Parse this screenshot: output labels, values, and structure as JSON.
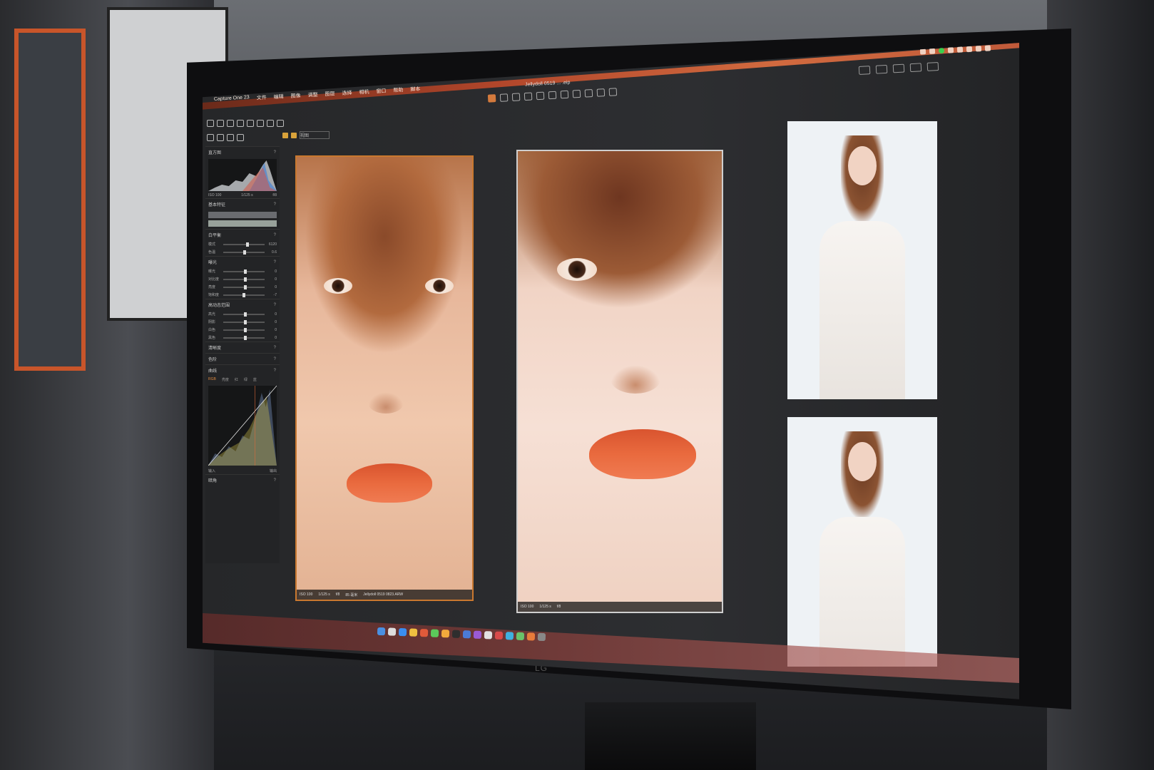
{
  "app": {
    "name": "Capture One 23",
    "document_title": "Jellydoll 0519 ... .eip"
  },
  "menu": {
    "items": [
      "Capture One 23",
      "文件",
      "编辑",
      "图像",
      "调整",
      "图层",
      "选择",
      "相机",
      "窗口",
      "帮助",
      "脚本"
    ]
  },
  "viewer": {
    "mode_label": "视图"
  },
  "left_panel": {
    "histogram_title": "直方图",
    "histogram_meta": [
      "ISO 100",
      "1/125 s",
      "f/8"
    ],
    "sections": {
      "basic": "基本特征",
      "white_balance": "白平衡",
      "exposure": "曝光",
      "hdr": "高动态范围",
      "clarity": "清晰度",
      "levels": "色阶",
      "curve": "曲线",
      "vignette": "暗角"
    },
    "wb_rows": [
      {
        "label": "模式",
        "value": "6120"
      },
      {
        "label": "色温",
        "value": "0.6"
      }
    ],
    "exposure_rows": [
      {
        "label": "曝光",
        "value": "0"
      },
      {
        "label": "对比度",
        "value": "0"
      },
      {
        "label": "亮度",
        "value": "0"
      },
      {
        "label": "饱和度",
        "value": "-7"
      }
    ],
    "hdr_rows": [
      {
        "label": "高光",
        "value": "0"
      },
      {
        "label": "阴影",
        "value": "0"
      },
      {
        "label": "白色",
        "value": "0"
      },
      {
        "label": "黑色",
        "value": "0"
      }
    ],
    "curve_tabs": [
      "RGB",
      "亮度",
      "红",
      "绿",
      "蓝"
    ],
    "curve_io": [
      "输入",
      "输出"
    ],
    "tool_label": "工具"
  },
  "photos": {
    "primary": {
      "caption": [
        "ISO 100",
        "1/125 s",
        "f/8",
        "85 毫米",
        "Jellydoll 0519 0823.ARW"
      ]
    },
    "secondary": {
      "caption": [
        "ISO 100",
        "1/125 s",
        "f/8"
      ]
    }
  },
  "colors": {
    "accent": "#d47a3d",
    "selection_frame": "#c9782f",
    "menubar": "#b0452a"
  },
  "hardware": {
    "monitor_logo": "LG"
  }
}
